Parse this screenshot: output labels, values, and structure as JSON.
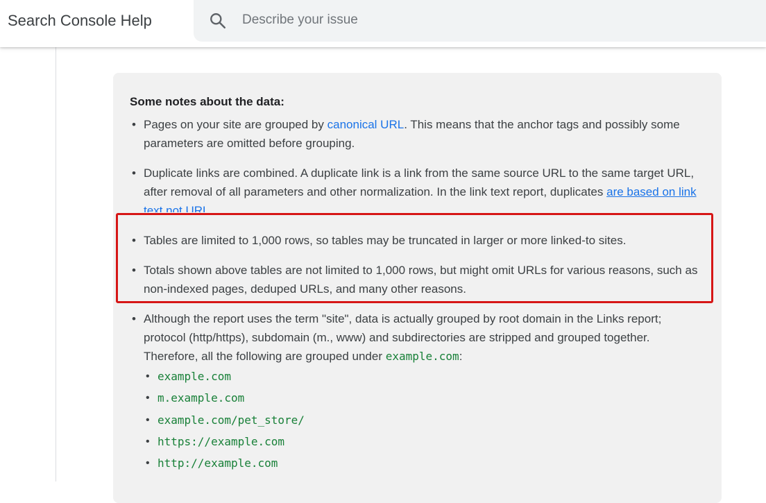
{
  "header": {
    "app_title": "Search Console Help",
    "search_placeholder": "Describe your issue",
    "search_value": ""
  },
  "notes": {
    "heading": "Some notes about the data:",
    "item1": {
      "pre": "Pages on your site are grouped by ",
      "link": "canonical URL",
      "post": ". This means that the anchor tags and possibly some parameters are omitted before grouping."
    },
    "item2": {
      "pre": "Duplicate links are combined. A duplicate link is a link from the same source URL to the same target URL, after removal of all parameters and other normalization. In the link text report, duplicates ",
      "link": "are based on link text not URL"
    },
    "item3": "Tables are limited to 1,000 rows, so tables may be truncated in larger or more linked-to sites.",
    "item4": "Totals shown above tables are not limited to 1,000 rows, but might omit URLs for various reasons, such as non-indexed pages, deduped URLs, and many other reasons.",
    "item5": {
      "pre": "Although the report uses the term \"site\", data is actually grouped by root domain in the Links report; protocol (http/https), subdomain (m., www) and subdirectories are stripped and grouped together. Therefore, all the following are grouped under ",
      "code": "example.com",
      "post": ":"
    },
    "examples": [
      "example.com",
      "m.example.com",
      "example.com/pet_store/",
      "https://example.com",
      "http://example.com"
    ]
  },
  "colors": {
    "highlight_border": "#d61616",
    "link": "#1a73e8",
    "code": "#188038",
    "note_background": "#f1f1f1"
  }
}
